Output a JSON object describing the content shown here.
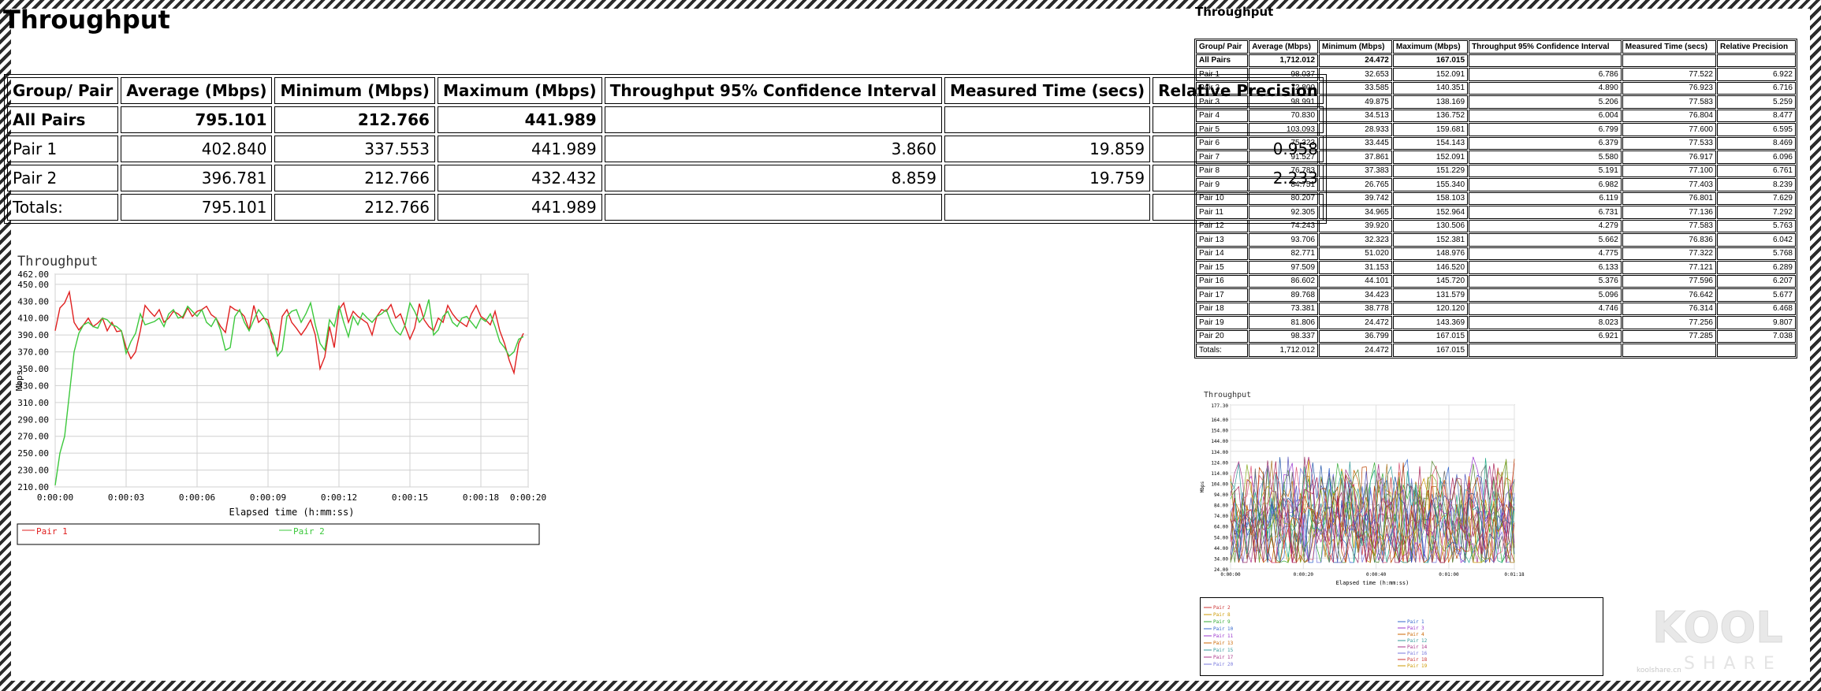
{
  "left": {
    "title": "Throughput",
    "table": {
      "headers": [
        "Group/ Pair",
        "Average (Mbps)",
        "Minimum (Mbps)",
        "Maximum (Mbps)",
        "Throughput 95% Confidence Interval",
        "Measured Time (secs)",
        "Relative Precision"
      ],
      "rows": [
        {
          "cells": [
            "All Pairs",
            "795.101",
            "212.766",
            "441.989",
            "",
            "",
            ""
          ]
        },
        {
          "cells": [
            "Pair 1",
            "402.840",
            "337.553",
            "441.989",
            "3.860",
            "19.859",
            "0.958"
          ]
        },
        {
          "cells": [
            "Pair 2",
            "396.781",
            "212.766",
            "432.432",
            "8.859",
            "19.759",
            "2.233"
          ]
        },
        {
          "cells": [
            "Totals:",
            "795.101",
            "212.766",
            "441.989",
            "",
            "",
            ""
          ]
        }
      ]
    }
  },
  "right": {
    "title": "Throughput",
    "table": {
      "headers": [
        "Group/ Pair",
        "Average (Mbps)",
        "Minimum (Mbps)",
        "Maximum (Mbps)",
        "Throughput 95% Confidence Interval",
        "Measured Time (secs)",
        "Relative Precision"
      ],
      "rows": [
        [
          "All Pairs",
          "1,712.012",
          "24.472",
          "167.015",
          "",
          "",
          ""
        ],
        [
          "Pair 1",
          "98.037",
          "32.653",
          "152.091",
          "6.786",
          "77.522",
          "6.922"
        ],
        [
          "Pair 2",
          "72.800",
          "33.585",
          "140.351",
          "4.890",
          "76.923",
          "6.716"
        ],
        [
          "Pair 3",
          "98.991",
          "49.875",
          "138.169",
          "5.206",
          "77.583",
          "5.259"
        ],
        [
          "Pair 4",
          "70.830",
          "34.513",
          "136.752",
          "6.004",
          "76.804",
          "8.477"
        ],
        [
          "Pair 5",
          "103.093",
          "28.933",
          "159.681",
          "6.799",
          "77.600",
          "6.595"
        ],
        [
          "Pair 6",
          "75.323",
          "33.445",
          "154.143",
          "6.379",
          "77.533",
          "8.469"
        ],
        [
          "Pair 7",
          "91.527",
          "37.861",
          "152.091",
          "5.580",
          "76.917",
          "6.096"
        ],
        [
          "Pair 8",
          "76.783",
          "37.383",
          "151.229",
          "5.191",
          "77.100",
          "6.761"
        ],
        [
          "Pair 9",
          "84.751",
          "26.765",
          "155.340",
          "6.982",
          "77.403",
          "8.239"
        ],
        [
          "Pair 10",
          "80.207",
          "39.742",
          "158.103",
          "6.119",
          "76.801",
          "7.629"
        ],
        [
          "Pair 11",
          "92.305",
          "34.965",
          "152.964",
          "6.731",
          "77.136",
          "7.292"
        ],
        [
          "Pair 12",
          "74.243",
          "39.920",
          "130.506",
          "4.279",
          "77.583",
          "5.763"
        ],
        [
          "Pair 13",
          "93.706",
          "32.323",
          "152.381",
          "5.662",
          "76.836",
          "6.042"
        ],
        [
          "Pair 14",
          "82.771",
          "51.020",
          "148.976",
          "4.775",
          "77.322",
          "5.768"
        ],
        [
          "Pair 15",
          "97.509",
          "31.153",
          "146.520",
          "6.133",
          "77.121",
          "6.289"
        ],
        [
          "Pair 16",
          "86.602",
          "44.101",
          "145.720",
          "5.376",
          "77.596",
          "6.207"
        ],
        [
          "Pair 17",
          "89.768",
          "34.423",
          "131.579",
          "5.096",
          "76.642",
          "5.677"
        ],
        [
          "Pair 18",
          "73.381",
          "38.778",
          "120.120",
          "4.746",
          "76.314",
          "6.468"
        ],
        [
          "Pair 19",
          "81.806",
          "24.472",
          "143.369",
          "8.023",
          "77.256",
          "9.807"
        ],
        [
          "Pair 20",
          "98.337",
          "36.799",
          "167.015",
          "6.921",
          "77.285",
          "7.038"
        ],
        [
          "Totals:",
          "1,712.012",
          "24.472",
          "167.015",
          "",
          "",
          ""
        ]
      ]
    }
  },
  "chart_data": [
    {
      "type": "line",
      "title": "Throughput",
      "xlabel": "Elapsed time (h:mm:ss)",
      "ylabel": "Mbps",
      "ylim": [
        210,
        462
      ],
      "xlim": [
        0,
        20
      ],
      "yticks": [
        "462.00",
        "450.00",
        "430.00",
        "410.00",
        "390.00",
        "370.00",
        "350.00",
        "330.00",
        "310.00",
        "290.00",
        "270.00",
        "250.00",
        "230.00",
        "210.00"
      ],
      "xticks": [
        "0:00:00",
        "0:00:03",
        "0:00:06",
        "0:00:09",
        "0:00:12",
        "0:00:15",
        "0:00:18",
        "0:00:20"
      ],
      "grid": true,
      "legend_position": "bottom",
      "series": [
        {
          "name": "Pair 1",
          "color": "#e02020",
          "x": [
            0,
            0.2,
            0.4,
            0.6,
            0.8,
            1.0,
            1.2,
            1.4,
            1.6,
            1.8,
            2.0,
            2.2,
            2.4,
            2.6,
            2.8,
            3.0,
            3.2,
            3.4,
            3.6,
            3.8,
            4.0,
            4.2,
            4.4,
            4.6,
            4.8,
            5.0,
            5.2,
            5.4,
            5.6,
            5.8,
            6.0,
            6.2,
            6.4,
            6.6,
            6.8,
            7.0,
            7.2,
            7.4,
            7.6,
            7.8,
            8.0,
            8.2,
            8.4,
            8.6,
            8.8,
            9.0,
            9.2,
            9.4,
            9.6,
            9.8,
            10.0,
            10.2,
            10.4,
            10.6,
            10.8,
            11.0,
            11.2,
            11.4,
            11.6,
            11.8,
            12.0,
            12.2,
            12.4,
            12.6,
            12.8,
            13.0,
            13.2,
            13.4,
            13.6,
            13.8,
            14.0,
            14.2,
            14.4,
            14.6,
            14.8,
            15.0,
            15.2,
            15.4,
            15.6,
            15.8,
            16.0,
            16.2,
            16.4,
            16.6,
            16.8,
            17.0,
            17.2,
            17.4,
            17.6,
            17.8,
            18.0,
            18.2,
            18.4,
            18.6,
            18.8,
            19.0,
            19.2,
            19.4,
            19.6,
            19.8
          ],
          "y": [
            395,
            422,
            428,
            441,
            405,
            396,
            402,
            410,
            400,
            404,
            410,
            395,
            405,
            394,
            395,
            375,
            362,
            370,
            395,
            425,
            418,
            412,
            420,
            405,
            410,
            418,
            415,
            410,
            422,
            412,
            418,
            420,
            424,
            414,
            410,
            400,
            393,
            424,
            420,
            418,
            412,
            396,
            425,
            405,
            410,
            408,
            382,
            372,
            412,
            420,
            405,
            398,
            390,
            398,
            408,
            390,
            350,
            364,
            400,
            375,
            420,
            428,
            405,
            418,
            412,
            408,
            404,
            390,
            412,
            420,
            418,
            426,
            410,
            415,
            400,
            385,
            398,
            427,
            408,
            400,
            395,
            410,
            405,
            425,
            415,
            408,
            404,
            400,
            415,
            425,
            412,
            408,
            402,
            418,
            395,
            380,
            360,
            345,
            380,
            392
          ],
          "y_note": ""
        },
        {
          "name": "Pair 2",
          "color": "#3cc83c",
          "x": [
            0,
            0.2,
            0.4,
            0.6,
            0.8,
            1.0,
            1.2,
            1.4,
            1.6,
            1.8,
            2.0,
            2.2,
            2.4,
            2.6,
            2.8,
            3.0,
            3.2,
            3.4,
            3.6,
            3.8,
            4.0,
            4.2,
            4.4,
            4.6,
            4.8,
            5.0,
            5.2,
            5.4,
            5.6,
            5.8,
            6.0,
            6.2,
            6.4,
            6.6,
            6.8,
            7.0,
            7.2,
            7.4,
            7.6,
            7.8,
            8.0,
            8.2,
            8.4,
            8.6,
            8.8,
            9.0,
            9.2,
            9.4,
            9.6,
            9.8,
            10.0,
            10.2,
            10.4,
            10.6,
            10.8,
            11.0,
            11.2,
            11.4,
            11.6,
            11.8,
            12.0,
            12.2,
            12.4,
            12.6,
            12.8,
            13.0,
            13.2,
            13.4,
            13.6,
            13.8,
            14.0,
            14.2,
            14.4,
            14.6,
            14.8,
            15.0,
            15.2,
            15.4,
            15.6,
            15.8,
            16.0,
            16.2,
            16.4,
            16.6,
            16.8,
            17.0,
            17.2,
            17.4,
            17.6,
            17.8,
            18.0,
            18.2,
            18.4,
            18.6,
            18.8,
            19.0,
            19.2,
            19.4,
            19.6,
            19.8
          ],
          "y": [
            212,
            250,
            270,
            320,
            370,
            392,
            402,
            405,
            400,
            398,
            410,
            408,
            402,
            400,
            395,
            368,
            382,
            392,
            415,
            402,
            404,
            406,
            410,
            400,
            415,
            420,
            410,
            412,
            424,
            418,
            412,
            420,
            405,
            400,
            410,
            395,
            372,
            375,
            412,
            420,
            405,
            395,
            408,
            420,
            412,
            402,
            390,
            365,
            372,
            412,
            418,
            420,
            405,
            415,
            428,
            402,
            380,
            372,
            408,
            400,
            425,
            405,
            388,
            412,
            402,
            416,
            410,
            405,
            412,
            415,
            420,
            405,
            395,
            390,
            402,
            428,
            418,
            405,
            412,
            432,
            390,
            396,
            412,
            418,
            405,
            400,
            410,
            412,
            405,
            398,
            410,
            406,
            415,
            400,
            382,
            375,
            365,
            370,
            385,
            388
          ]
        }
      ]
    },
    {
      "type": "line",
      "title": "Throughput",
      "xlabel": "Elapsed time (h:mm:ss)",
      "ylabel": "Mbps",
      "ylim": [
        24,
        177.3
      ],
      "yticks": [
        "177.30",
        "164.00",
        "154.00",
        "144.00",
        "134.00",
        "124.00",
        "114.00",
        "104.00",
        "94.00",
        "84.00",
        "74.00",
        "64.00",
        "54.00",
        "44.00",
        "34.00",
        "24.00"
      ],
      "xticks": [
        "0:00:00",
        "0:00:20",
        "0:00:40",
        "0:01:00",
        "0:01:18"
      ],
      "grid": true,
      "legend_position": "bottom",
      "series_names": [
        "Pair 1",
        "Pair 2",
        "Pair 3",
        "Pair 4",
        "Pair 5",
        "Pair 6",
        "Pair 7",
        "Pair 8",
        "Pair 9",
        "Pair 10",
        "Pair 11",
        "Pair 12",
        "Pair 13",
        "Pair 14",
        "Pair 15",
        "Pair 16",
        "Pair 17",
        "Pair 18",
        "Pair 19",
        "Pair 20"
      ]
    }
  ],
  "legend_left": {
    "pair1": "Pair 1",
    "pair2": "Pair 2"
  },
  "mini_legend": {
    "left_col": [
      "Pair 2",
      "Pair 8",
      "Pair 9",
      "Pair 10",
      "Pair 11",
      "Pair 13",
      "Pair 15",
      "Pair 17",
      "Pair 20"
    ],
    "right_col": [
      "Pair 1",
      "Pair 3",
      "Pair 4",
      "Pair 12",
      "Pair 14",
      "Pair 16",
      "Pair 18",
      "Pair 19"
    ],
    "colors": [
      "#cc3333",
      "#cc9900",
      "#33aa33",
      "#3366cc",
      "#9933cc",
      "#cc6600",
      "#339999",
      "#aa3388",
      "#7777dd"
    ]
  },
  "watermark": {
    "line1": "KOOL",
    "line2": "SHARE",
    "small": "koolshare.cn"
  }
}
